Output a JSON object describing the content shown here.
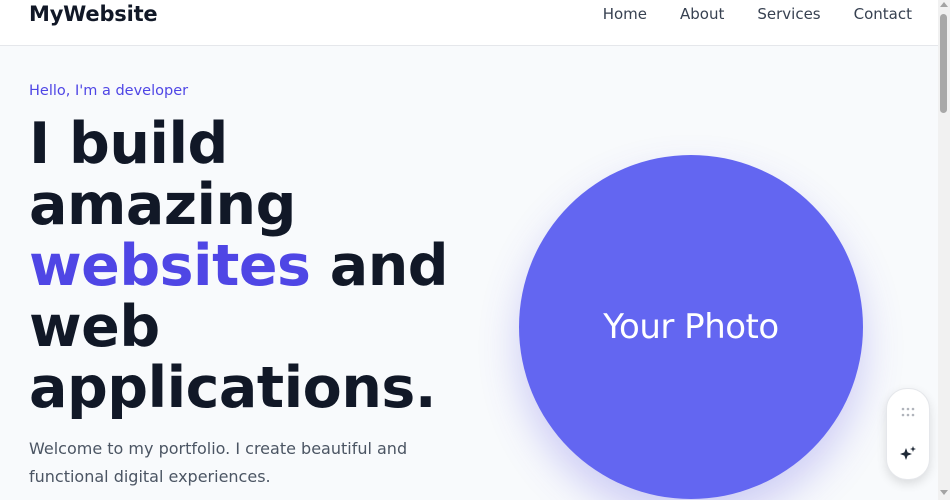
{
  "header": {
    "brand": "MyWebsite",
    "nav": [
      "Home",
      "About",
      "Services",
      "Contact"
    ]
  },
  "hero": {
    "eyebrow": "Hello, I'm a developer",
    "headline": {
      "part1": "I build amazing ",
      "accent": "websites",
      "part2": " and web applications."
    },
    "intro": "Welcome to my portfolio. I create beautiful and functional digital experiences.",
    "photo_label": "Your Photo"
  },
  "floating_toolbar": {
    "icons": [
      "grid-dots-icon",
      "sparkle-icon"
    ]
  },
  "colors": {
    "accent": "#4f46e5",
    "photo_bg": "#6366f1",
    "text_dark": "#111827",
    "text_muted": "#4b5563",
    "page_bg": "#f8fafc"
  }
}
